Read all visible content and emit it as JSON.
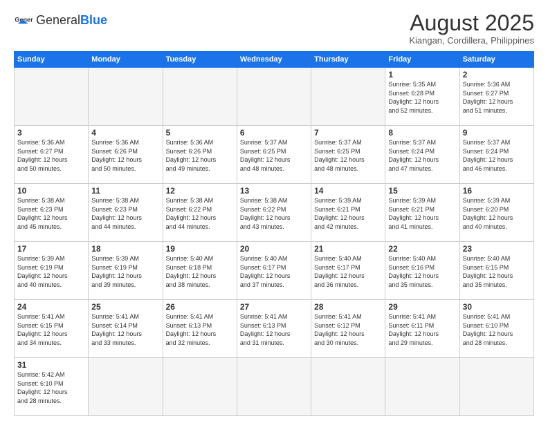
{
  "header": {
    "logo_general": "General",
    "logo_blue": "Blue",
    "title": "August 2025",
    "subtitle": "Kiangan, Cordillera, Philippines"
  },
  "weekdays": [
    "Sunday",
    "Monday",
    "Tuesday",
    "Wednesday",
    "Thursday",
    "Friday",
    "Saturday"
  ],
  "weeks": [
    [
      {
        "day": "",
        "info": "",
        "empty": true
      },
      {
        "day": "",
        "info": "",
        "empty": true
      },
      {
        "day": "",
        "info": "",
        "empty": true
      },
      {
        "day": "",
        "info": "",
        "empty": true
      },
      {
        "day": "",
        "info": "",
        "empty": true
      },
      {
        "day": "1",
        "info": "Sunrise: 5:35 AM\nSunset: 6:28 PM\nDaylight: 12 hours\nand 52 minutes."
      },
      {
        "day": "2",
        "info": "Sunrise: 5:36 AM\nSunset: 6:27 PM\nDaylight: 12 hours\nand 51 minutes."
      }
    ],
    [
      {
        "day": "3",
        "info": "Sunrise: 5:36 AM\nSunset: 6:27 PM\nDaylight: 12 hours\nand 50 minutes."
      },
      {
        "day": "4",
        "info": "Sunrise: 5:36 AM\nSunset: 6:26 PM\nDaylight: 12 hours\nand 50 minutes."
      },
      {
        "day": "5",
        "info": "Sunrise: 5:36 AM\nSunset: 6:26 PM\nDaylight: 12 hours\nand 49 minutes."
      },
      {
        "day": "6",
        "info": "Sunrise: 5:37 AM\nSunset: 6:25 PM\nDaylight: 12 hours\nand 48 minutes."
      },
      {
        "day": "7",
        "info": "Sunrise: 5:37 AM\nSunset: 6:25 PM\nDaylight: 12 hours\nand 48 minutes."
      },
      {
        "day": "8",
        "info": "Sunrise: 5:37 AM\nSunset: 6:24 PM\nDaylight: 12 hours\nand 47 minutes."
      },
      {
        "day": "9",
        "info": "Sunrise: 5:37 AM\nSunset: 6:24 PM\nDaylight: 12 hours\nand 46 minutes."
      }
    ],
    [
      {
        "day": "10",
        "info": "Sunrise: 5:38 AM\nSunset: 6:23 PM\nDaylight: 12 hours\nand 45 minutes."
      },
      {
        "day": "11",
        "info": "Sunrise: 5:38 AM\nSunset: 6:23 PM\nDaylight: 12 hours\nand 44 minutes."
      },
      {
        "day": "12",
        "info": "Sunrise: 5:38 AM\nSunset: 6:22 PM\nDaylight: 12 hours\nand 44 minutes."
      },
      {
        "day": "13",
        "info": "Sunrise: 5:38 AM\nSunset: 6:22 PM\nDaylight: 12 hours\nand 43 minutes."
      },
      {
        "day": "14",
        "info": "Sunrise: 5:39 AM\nSunset: 6:21 PM\nDaylight: 12 hours\nand 42 minutes."
      },
      {
        "day": "15",
        "info": "Sunrise: 5:39 AM\nSunset: 6:21 PM\nDaylight: 12 hours\nand 41 minutes."
      },
      {
        "day": "16",
        "info": "Sunrise: 5:39 AM\nSunset: 6:20 PM\nDaylight: 12 hours\nand 40 minutes."
      }
    ],
    [
      {
        "day": "17",
        "info": "Sunrise: 5:39 AM\nSunset: 6:19 PM\nDaylight: 12 hours\nand 40 minutes."
      },
      {
        "day": "18",
        "info": "Sunrise: 5:39 AM\nSunset: 6:19 PM\nDaylight: 12 hours\nand 39 minutes."
      },
      {
        "day": "19",
        "info": "Sunrise: 5:40 AM\nSunset: 6:18 PM\nDaylight: 12 hours\nand 38 minutes."
      },
      {
        "day": "20",
        "info": "Sunrise: 5:40 AM\nSunset: 6:17 PM\nDaylight: 12 hours\nand 37 minutes."
      },
      {
        "day": "21",
        "info": "Sunrise: 5:40 AM\nSunset: 6:17 PM\nDaylight: 12 hours\nand 36 minutes."
      },
      {
        "day": "22",
        "info": "Sunrise: 5:40 AM\nSunset: 6:16 PM\nDaylight: 12 hours\nand 35 minutes."
      },
      {
        "day": "23",
        "info": "Sunrise: 5:40 AM\nSunset: 6:15 PM\nDaylight: 12 hours\nand 35 minutes."
      }
    ],
    [
      {
        "day": "24",
        "info": "Sunrise: 5:41 AM\nSunset: 6:15 PM\nDaylight: 12 hours\nand 34 minutes."
      },
      {
        "day": "25",
        "info": "Sunrise: 5:41 AM\nSunset: 6:14 PM\nDaylight: 12 hours\nand 33 minutes."
      },
      {
        "day": "26",
        "info": "Sunrise: 5:41 AM\nSunset: 6:13 PM\nDaylight: 12 hours\nand 32 minutes."
      },
      {
        "day": "27",
        "info": "Sunrise: 5:41 AM\nSunset: 6:13 PM\nDaylight: 12 hours\nand 31 minutes."
      },
      {
        "day": "28",
        "info": "Sunrise: 5:41 AM\nSunset: 6:12 PM\nDaylight: 12 hours\nand 30 minutes."
      },
      {
        "day": "29",
        "info": "Sunrise: 5:41 AM\nSunset: 6:11 PM\nDaylight: 12 hours\nand 29 minutes."
      },
      {
        "day": "30",
        "info": "Sunrise: 5:41 AM\nSunset: 6:10 PM\nDaylight: 12 hours\nand 28 minutes."
      }
    ],
    [
      {
        "day": "31",
        "info": "Sunrise: 5:42 AM\nSunset: 6:10 PM\nDaylight: 12 hours\nand 28 minutes."
      },
      {
        "day": "",
        "info": "",
        "empty": true
      },
      {
        "day": "",
        "info": "",
        "empty": true
      },
      {
        "day": "",
        "info": "",
        "empty": true
      },
      {
        "day": "",
        "info": "",
        "empty": true
      },
      {
        "day": "",
        "info": "",
        "empty": true
      },
      {
        "day": "",
        "info": "",
        "empty": true
      }
    ]
  ]
}
